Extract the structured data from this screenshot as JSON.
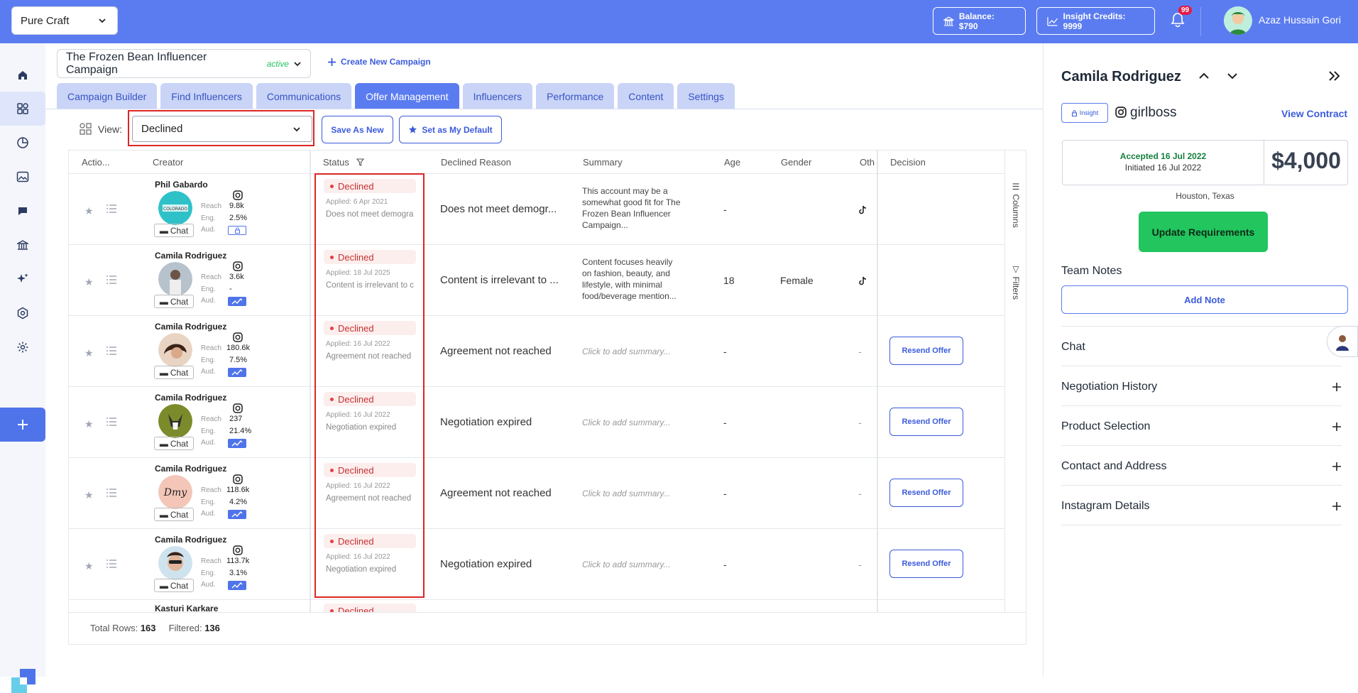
{
  "topbar": {
    "brand": "Pure Craft",
    "balance": "Balance: $790",
    "credits": "Insight Credits: 9999",
    "notifications_count": "99",
    "user_name": "Azaz Hussain Gori"
  },
  "campaign": {
    "name": "The Frozen Bean Influencer Campaign",
    "status": "active",
    "create_label": "Create New Campaign"
  },
  "tabs": [
    "Campaign Builder",
    "Find Influencers",
    "Communications",
    "Offer Management",
    "Influencers",
    "Performance",
    "Content",
    "Settings"
  ],
  "view": {
    "label": "View:",
    "selected": "Declined",
    "save_as_new": "Save As New",
    "set_default": "Set as My Default"
  },
  "table": {
    "columns": [
      "Actio...",
      "Creator",
      "Status",
      "Declined Reason",
      "Summary",
      "Age",
      "Gender",
      "Oth",
      "Decision"
    ],
    "side_tools": [
      "Columns",
      "Filters"
    ],
    "metric_labels": [
      "Reach",
      "Eng.",
      "Aud."
    ],
    "chat_label": "Chat",
    "rows": [
      {
        "name": "Phil Gabardo",
        "reach": "9.8k",
        "eng": "2.5%",
        "status": "Declined",
        "applied": "Applied: 6 Apr 2021",
        "status_reason": "Does not meet demogra",
        "declined_reason": "Does not meet demogr...",
        "summary": "This account may be a somewhat good fit for The Frozen Bean Influencer Campaign...",
        "age": "-",
        "gender": "",
        "other": "tiktok",
        "decision": ""
      },
      {
        "name": "Camila Rodriguez",
        "reach": "3.6k",
        "eng": "-",
        "status": "Declined",
        "applied": "Applied: 18 Jul 2025",
        "status_reason": "Content is irrelevant to c",
        "declined_reason": "Content is irrelevant to ...",
        "summary": "Content focuses heavily on fashion, beauty, and lifestyle, with minimal food/beverage mention...",
        "age": "18",
        "gender": "Female",
        "other": "tiktok",
        "decision": ""
      },
      {
        "name": "Camila Rodriguez",
        "reach": "180.6k",
        "eng": "7.5%",
        "status": "Declined",
        "applied": "Applied: 16 Jul 2022",
        "status_reason": "Agreement not reached",
        "declined_reason": "Agreement not reached",
        "summary": "Click to add summary...",
        "age": "-",
        "gender": "",
        "other": "-",
        "decision": "Resend Offer"
      },
      {
        "name": "Camila Rodriguez",
        "reach": "237",
        "eng": "21.4%",
        "status": "Declined",
        "applied": "Applied: 16 Jul 2022",
        "status_reason": "Negotiation expired",
        "declined_reason": "Negotiation expired",
        "summary": "Click to add summary...",
        "age": "-",
        "gender": "",
        "other": "-",
        "decision": "Resend Offer"
      },
      {
        "name": "Camila Rodriguez",
        "reach": "118.6k",
        "eng": "4.2%",
        "status": "Declined",
        "applied": "Applied: 16 Jul 2022",
        "status_reason": "Agreement not reached",
        "declined_reason": "Agreement not reached",
        "summary": "Click to add summary...",
        "age": "-",
        "gender": "",
        "other": "-",
        "decision": "Resend Offer"
      },
      {
        "name": "Camila Rodriguez",
        "reach": "113.7k",
        "eng": "3.1%",
        "status": "Declined",
        "applied": "Applied: 16 Jul 2022",
        "status_reason": "Negotiation expired",
        "declined_reason": "Negotiation expired",
        "summary": "Click to add summary...",
        "age": "-",
        "gender": "",
        "other": "-",
        "decision": "Resend Offer"
      },
      {
        "name": "Kasturi Karkare",
        "status": "Declined"
      }
    ],
    "footer": {
      "total_label": "Total Rows:",
      "total": "163",
      "filtered_label": "Filtered:",
      "filtered": "136"
    }
  },
  "panel": {
    "name": "Camila Rodriguez",
    "insight_label": "Insight",
    "handle": "girlboss",
    "view_contract": "View Contract",
    "accepted": "Accepted 16 Jul 2022",
    "initiated": "Initiated 16 Jul 2022",
    "price": "$4,000",
    "location": "Houston, Texas",
    "update_requirements": "Update Requirements",
    "team_notes": "Team Notes",
    "add_note": "Add Note",
    "sections": [
      "Chat",
      "Negotiation History",
      "Product Selection",
      "Contact and Address",
      "Instagram Details"
    ]
  },
  "colors": {
    "topbar": "#5b7cf0",
    "accent": "#3b5bdb",
    "declined": "#c53030",
    "success": "#22c55e"
  }
}
